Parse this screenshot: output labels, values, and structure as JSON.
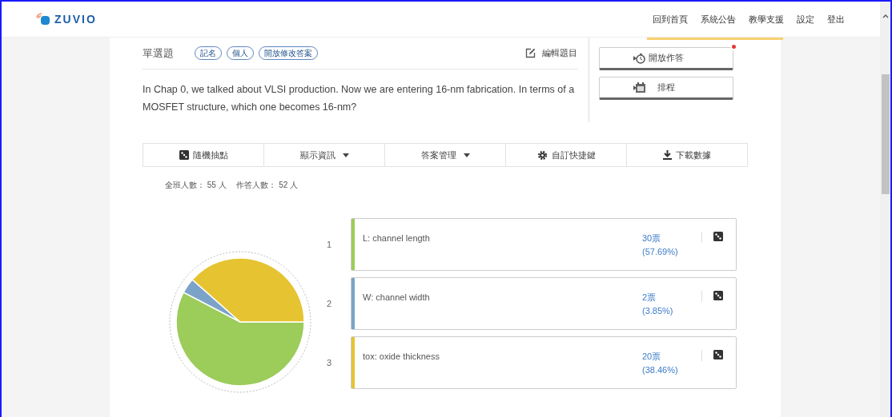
{
  "header": {
    "logo": "ZUVIO",
    "nav": [
      "回到首頁",
      "系統公告",
      "教學支援",
      "設定",
      "登出"
    ]
  },
  "question": {
    "type": "單選題",
    "tags": [
      "記名",
      "個人",
      "開放修改答案"
    ],
    "edit": "編輯題目",
    "text": "In Chap 0, we talked about VLSI production. Now we are entering 16-nm fabrication. In terms of a MOSFET structure, which one becomes 16-nm?"
  },
  "actions": [
    {
      "label": "開放作答",
      "kind": "timer",
      "badge": true
    },
    {
      "label": "排程",
      "kind": "calendar",
      "badge": false
    }
  ],
  "toolbar": [
    {
      "label": "隨機抽點",
      "kind": "dice"
    },
    {
      "label": "顯示資訊",
      "kind": "dropdown"
    },
    {
      "label": "答案管理",
      "kind": "dropdown"
    },
    {
      "label": "自訂快捷鍵",
      "kind": "gear"
    },
    {
      "label": "下載數據",
      "kind": "download"
    }
  ],
  "stats": "全班人數： 55 人　 作答人數： 52 人",
  "options": [
    {
      "number": "1",
      "text": "L: channel length",
      "votes": "30票",
      "percent": "(57.69%)",
      "color": "#9ccc5a"
    },
    {
      "number": "2",
      "text": "W: channel width",
      "votes": "2票",
      "percent": "(3.85%)",
      "color": "#7ba3c8"
    },
    {
      "number": "3",
      "text": "tox: oxide thickness",
      "votes": "20票",
      "percent": "(38.46%)",
      "color": "#e6c331"
    }
  ]
}
